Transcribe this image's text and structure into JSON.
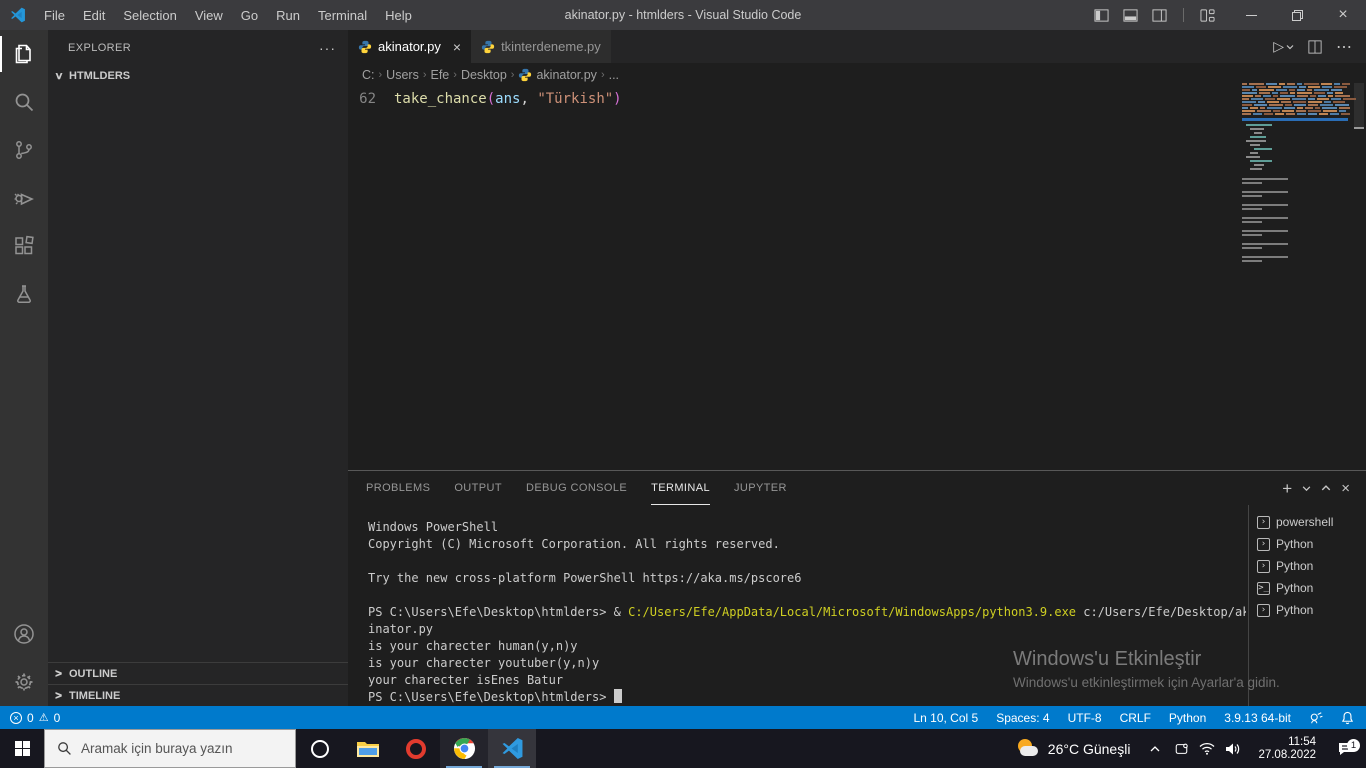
{
  "titlebar": {
    "menus": [
      "File",
      "Edit",
      "Selection",
      "View",
      "Go",
      "Run",
      "Terminal",
      "Help"
    ],
    "title": "akinator.py - htmlders - Visual Studio Code",
    "layout_icons": [
      "toggle-sidebar",
      "toggle-panel",
      "toggle-secondary-sidebar",
      "customize-layout"
    ],
    "window_controls": [
      "minimize",
      "restore",
      "close"
    ]
  },
  "activity_bar": {
    "items": [
      {
        "name": "explorer",
        "active": true
      },
      {
        "name": "search",
        "active": false
      },
      {
        "name": "source-control",
        "active": false
      },
      {
        "name": "run-debug",
        "active": false
      },
      {
        "name": "extensions",
        "active": false
      },
      {
        "name": "testing",
        "active": false
      }
    ],
    "bottom_items": [
      {
        "name": "accounts"
      },
      {
        "name": "settings"
      }
    ]
  },
  "sidebar": {
    "header": "EXPLORER",
    "more_label": "···",
    "folder": "HTMLDERS",
    "sections": [
      "OUTLINE",
      "TIMELINE"
    ]
  },
  "editor": {
    "tabs": [
      {
        "label": "akinator.py",
        "active": true,
        "closable": true
      },
      {
        "label": "tkinterdeneme.py",
        "active": false,
        "closable": false
      }
    ],
    "actions": [
      "run",
      "run-dropdown",
      "split-editor",
      "more-actions"
    ],
    "breadcrumb": [
      {
        "label": "C:"
      },
      {
        "label": "Users"
      },
      {
        "label": "Efe"
      },
      {
        "label": "Desktop"
      },
      {
        "label": "akinator.py",
        "icon": "python"
      },
      {
        "label": "..."
      }
    ],
    "line_number": "62",
    "code_segments": [
      {
        "t": "take_chance",
        "c": "func"
      },
      {
        "t": "(",
        "c": "bracket"
      },
      {
        "t": "ans",
        "c": "var"
      },
      {
        "t": ", ",
        "c": "fg"
      },
      {
        "t": "\"Türkish\"",
        "c": "str"
      },
      {
        "t": ")",
        "c": "bracket"
      }
    ]
  },
  "panel": {
    "tabs": [
      {
        "label": "PROBLEMS",
        "active": false
      },
      {
        "label": "OUTPUT",
        "active": false
      },
      {
        "label": "DEBUG CONSOLE",
        "active": false
      },
      {
        "label": "TERMINAL",
        "active": true
      },
      {
        "label": "JUPYTER",
        "active": false
      }
    ],
    "actions": [
      "new-terminal",
      "terminal-dropdown",
      "maximize-panel",
      "close-panel"
    ],
    "terminal_lines": [
      {
        "segments": [
          {
            "t": "Windows PowerShell"
          }
        ]
      },
      {
        "segments": [
          {
            "t": "Copyright (C) Microsoft Corporation. All rights reserved."
          }
        ]
      },
      {
        "segments": [
          {
            "t": ""
          }
        ]
      },
      {
        "segments": [
          {
            "t": "Try the new cross-platform PowerShell https://aka.ms/pscore6"
          }
        ]
      },
      {
        "segments": [
          {
            "t": ""
          }
        ]
      },
      {
        "segments": [
          {
            "t": "PS C:\\Users\\Efe\\Desktop\\htmlders> & "
          },
          {
            "t": "C:/Users/Efe/AppData/Local/Microsoft/WindowsApps/python3.9.exe",
            "c": "yellow"
          },
          {
            "t": " c:/Users/Efe/Desktop/ak"
          }
        ]
      },
      {
        "segments": [
          {
            "t": "inator.py"
          }
        ]
      },
      {
        "segments": [
          {
            "t": "is your charecter human(y,n)y"
          }
        ]
      },
      {
        "segments": [
          {
            "t": "is your charecter youtuber(y,n)y"
          }
        ]
      },
      {
        "segments": [
          {
            "t": "your charecter isEnes Batur"
          }
        ]
      },
      {
        "segments": [
          {
            "t": "PS C:\\Users\\Efe\\Desktop\\htmlders> "
          },
          {
            "t": "",
            "c": "cursor"
          }
        ]
      }
    ],
    "terminal_list": [
      {
        "icon": "shell-chevron",
        "label": "powershell"
      },
      {
        "icon": "shell-chevron",
        "label": "Python"
      },
      {
        "icon": "shell-chevron",
        "label": "Python"
      },
      {
        "icon": "terminal-window",
        "label": "Python"
      },
      {
        "icon": "shell-chevron",
        "label": "Python"
      }
    ]
  },
  "watermark": {
    "line1": "Windows'u Etkinleştir",
    "line2": "Windows'u etkinleştirmek için Ayarlar'a gidin."
  },
  "status_bar": {
    "errors": "0",
    "warnings": "0",
    "items": [
      "Ln 10, Col 5",
      "Spaces: 4",
      "UTF-8",
      "CRLF",
      "Python",
      "3.9.13 64-bit"
    ],
    "right_icons": [
      "feedback",
      "bell"
    ]
  },
  "taskbar": {
    "search_placeholder": "Aramak için buraya yazın",
    "apps": [
      {
        "name": "cortana",
        "running": false
      },
      {
        "name": "file-explorer",
        "running": false
      },
      {
        "name": "opera",
        "running": false
      },
      {
        "name": "chrome",
        "running": true
      },
      {
        "name": "vscode",
        "running": true,
        "focused": true
      }
    ],
    "weather_text": "26°C Güneşli",
    "tray_icons": [
      "chevron-up",
      "tablet",
      "wifi",
      "volume"
    ],
    "time": "11:54",
    "date": "27.08.2022",
    "notification_count": "1"
  },
  "colors": {
    "statusbar": "#007acc",
    "titlebar": "#3b3b3e",
    "activitybar": "#333333",
    "sidebar": "#252526",
    "editor": "#1e1e1e",
    "taskbar": "#17171f",
    "terminal_yellow": "#cfcf22",
    "python_blue": "#3776ab",
    "python_yellow": "#ffd43b"
  }
}
